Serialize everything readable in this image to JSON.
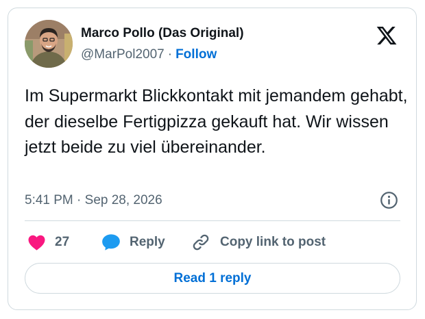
{
  "author": {
    "display_name": "Marco Pollo (Das Original)",
    "handle": "@MarPol2007",
    "separator": "·",
    "follow_label": "Follow"
  },
  "brand": {
    "logo_icon": "x-logo-icon"
  },
  "tweet": {
    "text": "Im Supermarkt Blickkontakt mit jemandem gehabt, der dieselbe Fertigpizza gekauft hat. Wir wissen jetzt beide zu viel übereinander.",
    "timestamp": "5:41 PM · Sep 28, 2026"
  },
  "actions": {
    "like_count": "27",
    "reply_label": "Reply",
    "copy_label": "Copy link to post"
  },
  "read_replies_label": "Read 1 reply",
  "icons": {
    "like": "heart-icon",
    "reply": "speech-bubble-icon",
    "copy": "link-icon",
    "info": "info-icon"
  },
  "colors": {
    "accent": "#006fd6",
    "like": "#f91880",
    "reply": "#1d9bf0",
    "secondary_text": "#536471",
    "border": "#cfd9de"
  }
}
